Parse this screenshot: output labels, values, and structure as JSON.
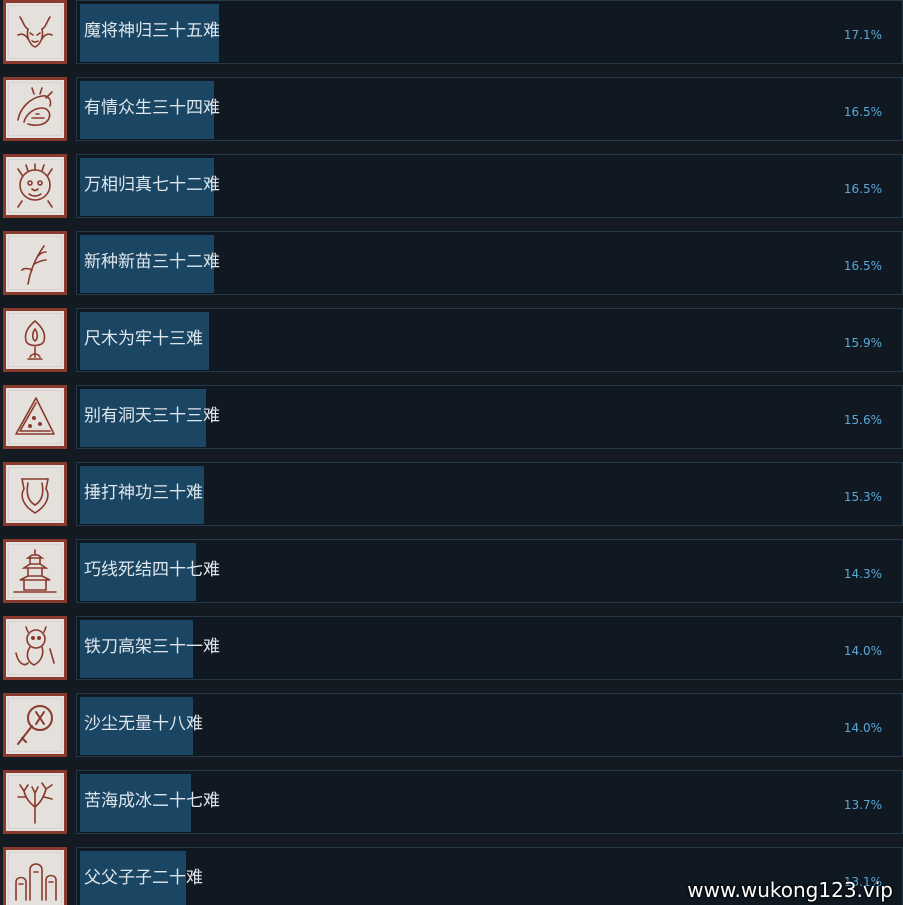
{
  "achievements": [
    {
      "name": "魔将神归三十五难",
      "percent": "17.1%",
      "value": 17.1,
      "icon": "demon-general-icon"
    },
    {
      "name": "有情众生三十四难",
      "percent": "16.5%",
      "value": 16.5,
      "icon": "dragon-creature-icon"
    },
    {
      "name": "万相归真七十二难",
      "percent": "16.5%",
      "value": 16.5,
      "icon": "monkey-face-icon"
    },
    {
      "name": "新种新苗三十二难",
      "percent": "16.5%",
      "value": 16.5,
      "icon": "sprout-icon"
    },
    {
      "name": "尺木为牢十三难",
      "percent": "15.9%",
      "value": 15.9,
      "icon": "flame-tree-icon"
    },
    {
      "name": "别有洞天三十三难",
      "percent": "15.6%",
      "value": 15.6,
      "icon": "watermelon-icon"
    },
    {
      "name": "捶打神功三十难",
      "percent": "15.3%",
      "value": 15.3,
      "icon": "bell-shield-icon"
    },
    {
      "name": "巧线死结四十七难",
      "percent": "14.3%",
      "value": 14.3,
      "icon": "pagoda-icon"
    },
    {
      "name": "铁刀高架三十一难",
      "percent": "14.0%",
      "value": 14.0,
      "icon": "rat-figure-icon"
    },
    {
      "name": "沙尘无量十八难",
      "percent": "14.0%",
      "value": 14.0,
      "icon": "magnifier-icon"
    },
    {
      "name": "苦海成冰二十七难",
      "percent": "13.7%",
      "value": 13.7,
      "icon": "coral-tree-icon"
    },
    {
      "name": "父父子子二十难",
      "percent": "13.1%",
      "value": 13.1,
      "icon": "stone-figures-icon"
    }
  ],
  "watermark": "www.wukong123.vip",
  "colors": {
    "background": "#131a22",
    "bar_fill": "#1a4664",
    "percent_text": "#5aa8d8",
    "icon_border": "#8a3a2c"
  }
}
